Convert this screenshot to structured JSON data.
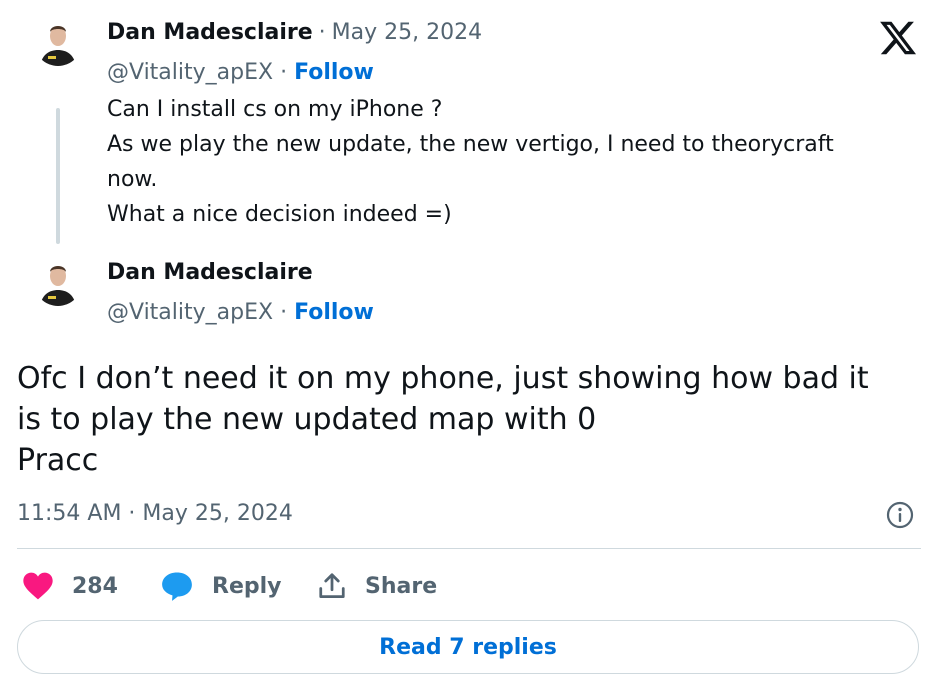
{
  "quoted_tweet": {
    "author_name": "Dan Madesclaire",
    "separator": "·",
    "date": "May 25, 2024",
    "handle": "@Vitality_apEX",
    "follow_label": "Follow",
    "lines": [
      "Can I install cs on my iPhone ?",
      "As we play the new update, the new vertigo, I need to theorycraft",
      "now.",
      "What a nice decision indeed =)"
    ]
  },
  "main_tweet": {
    "author_name": "Dan Madesclaire",
    "handle": "@Vitality_apEX",
    "separator": "·",
    "follow_label": "Follow",
    "lines": [
      "Ofc I don’t need it on my phone, just showing how bad it",
      "is to play the new updated map with 0",
      "Pracc"
    ],
    "timestamp": "11:54 AM · May 25, 2024"
  },
  "actions": {
    "like_count": "284",
    "reply_label": "Reply",
    "share_label": "Share"
  },
  "read_replies_label": "Read 7 replies",
  "icons": {
    "brand": "x-logo-icon",
    "info": "info-icon",
    "like": "heart-icon",
    "reply": "speech-bubble-icon",
    "share": "share-icon"
  },
  "colors": {
    "link": "#006fd6",
    "heart": "#f91880",
    "reply_icon": "#1d9bf0",
    "muted": "#536471",
    "border": "#cfd9de"
  }
}
